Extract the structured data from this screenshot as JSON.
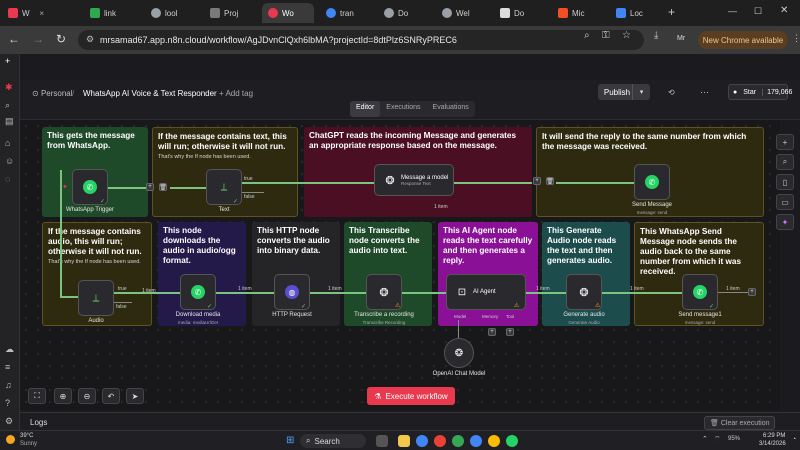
{
  "browser": {
    "tabs": [
      {
        "label": "W",
        "color": "#e8394f",
        "active": false
      },
      {
        "label": "link",
        "color": "#2fa84f",
        "active": false
      },
      {
        "label": "lool",
        "color": "#9aa0a6",
        "active": false
      },
      {
        "label": "Proj",
        "color": "#7a7a7a",
        "active": false
      },
      {
        "label": "Wo",
        "color": "#e8394f",
        "active": true
      },
      {
        "label": "tran",
        "color": "#4285f4",
        "active": false
      },
      {
        "label": "Do",
        "color": "#9aa0a6",
        "active": false
      },
      {
        "label": "Wel",
        "color": "#9aa0a6",
        "active": false
      },
      {
        "label": "Do",
        "color": "#ddd",
        "active": false
      },
      {
        "label": "Mic",
        "color": "#f25022",
        "active": false
      },
      {
        "label": "Loc",
        "color": "#4285f4",
        "active": false
      }
    ],
    "url": "mrsamad67.app.n8n.cloud/workflow/AgJDvnClQxh6lbMA?projectId=8dtPlz6SNRyPREC6",
    "profile": "Mr",
    "new_chrome": "New Chrome available"
  },
  "header": {
    "personal": "Personal",
    "workflow_name": "WhatsApp AI Voice & Text Responder",
    "add_tag": "+ Add tag",
    "publish": "Publish",
    "github_star": "Star",
    "star_count": "179,066",
    "tabs": [
      "Editor",
      "Executions",
      "Evaluations"
    ]
  },
  "notes": {
    "n1": "This gets the message from WhatsApp.",
    "n2": "If the message contains text, this will run; otherwise it will not run.",
    "n2s": "That's why the If node has been used.",
    "n3": "ChatGPT reads the incoming Message and generates an appropriate response based on the message.",
    "n4": "It will send the reply to the same number from which the message was received.",
    "n5": "If the message contains audio, this will run; otherwise it will not run.",
    "n5s": "That's why the If node has been used.",
    "n6": "This node downloads the audio in audio/ogg format.",
    "n7": "This HTTP node converts the audio into binary data.",
    "n8": "This Transcribe node converts the audio into text.",
    "n9": "This AI Agent node reads the text carefully and then generates a reply.",
    "n10": "This Generate Audio node reads the text and then generates audio.",
    "n11": "This WhatsApp Send Message node sends the audio back to the same number from which it was received."
  },
  "nodes": {
    "trigger": "WhatsApp Trigger",
    "text": "Text",
    "message_model": "Message a model",
    "message_model_sub": "Response Text",
    "send_message": "Send Message",
    "send_message_sub": "message: send",
    "audio": "Audio",
    "download_media": "Download media",
    "download_media_sub": "media: mediaUrlGet",
    "http_request": "HTTP Request",
    "transcribe": "Transcribe a recording",
    "transcribe_sub": "Transcribe Recording",
    "ai_agent": "AI Agent",
    "generate_audio": "Generate audio",
    "generate_audio_sub": "Generate Audio",
    "send_message1": "Send message1",
    "send_message1_sub": "message: send",
    "openai_model": "OpenAI Chat Model",
    "model_label": "Model",
    "memory_label": "Memory",
    "tool_label": "Tool"
  },
  "edges": {
    "true": "true",
    "false": "false",
    "item": "1 item",
    "items": "1 item"
  },
  "controls": {
    "execute": "Execute workflow",
    "logs": "Logs",
    "clear": "Clear execution"
  },
  "taskbar": {
    "weather_temp": "39°C",
    "weather_desc": "Sunny",
    "search": "Search",
    "time": "6:29 PM",
    "date": "3/14/2026",
    "battery": "95%"
  }
}
